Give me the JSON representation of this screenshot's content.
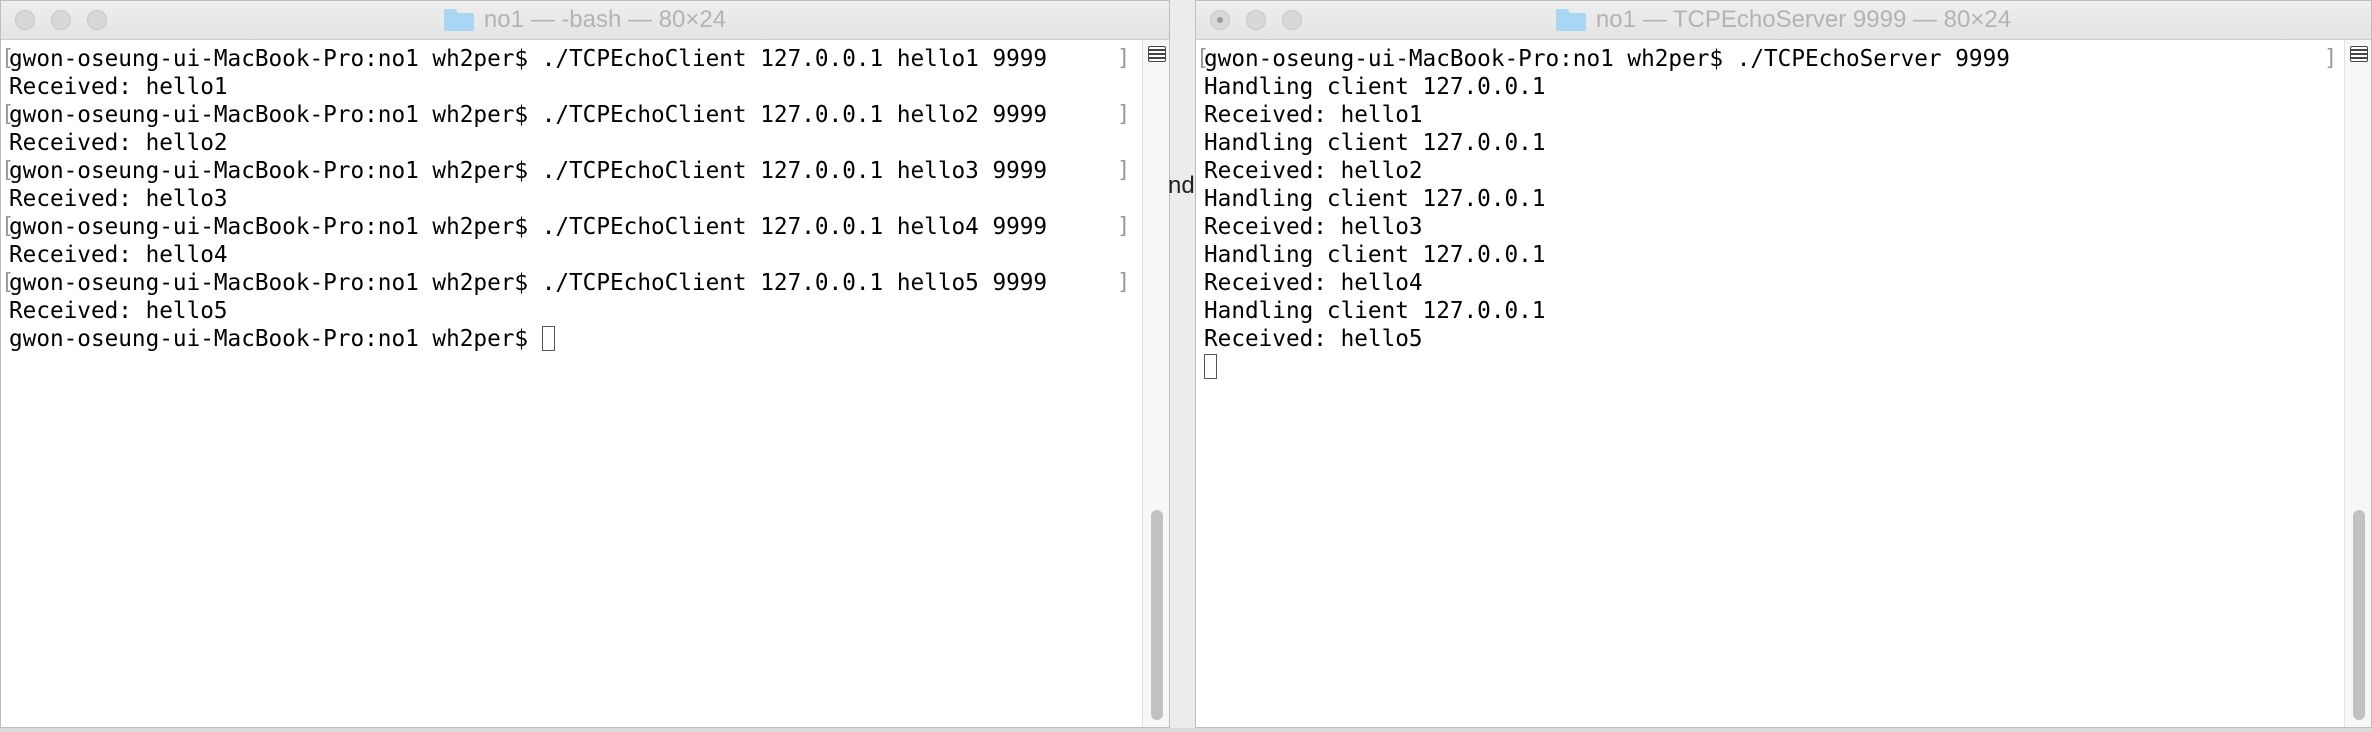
{
  "left_window": {
    "title": "no1 — -bash — 80×24",
    "folder_icon": "folder-icon",
    "lines": [
      "gwon-oseung-ui-MacBook-Pro:no1 wh2per$ ./TCPEchoClient 127.0.0.1 hello1 9999",
      "Received: hello1",
      "gwon-oseung-ui-MacBook-Pro:no1 wh2per$ ./TCPEchoClient 127.0.0.1 hello2 9999",
      "Received: hello2",
      "gwon-oseung-ui-MacBook-Pro:no1 wh2per$ ./TCPEchoClient 127.0.0.1 hello3 9999",
      "Received: hello3",
      "gwon-oseung-ui-MacBook-Pro:no1 wh2per$ ./TCPEchoClient 127.0.0.1 hello4 9999",
      "Received: hello4",
      "gwon-oseung-ui-MacBook-Pro:no1 wh2per$ ./TCPEchoClient 127.0.0.1 hello5 9999",
      "Received: hello5",
      "gwon-oseung-ui-MacBook-Pro:no1 wh2per$ "
    ]
  },
  "right_window": {
    "title": "no1 — TCPEchoServer 9999 — 80×24",
    "folder_icon": "folder-icon",
    "lines": [
      "gwon-oseung-ui-MacBook-Pro:no1 wh2per$ ./TCPEchoServer 9999",
      "Handling client 127.0.0.1",
      "Received: hello1",
      "Handling client 127.0.0.1",
      "Received: hello2",
      "Handling client 127.0.0.1",
      "Received: hello3",
      "Handling client 127.0.0.1",
      "Received: hello4",
      "Handling client 127.0.0.1",
      "Received: hello5",
      ""
    ]
  },
  "background_peek": "nd",
  "colors": {
    "terminal_bg": "#ffffff",
    "text": "#000000",
    "titlebar": "#e8e8e8",
    "title_text": "#b3b3b3",
    "folder": "#a9d7f3"
  }
}
